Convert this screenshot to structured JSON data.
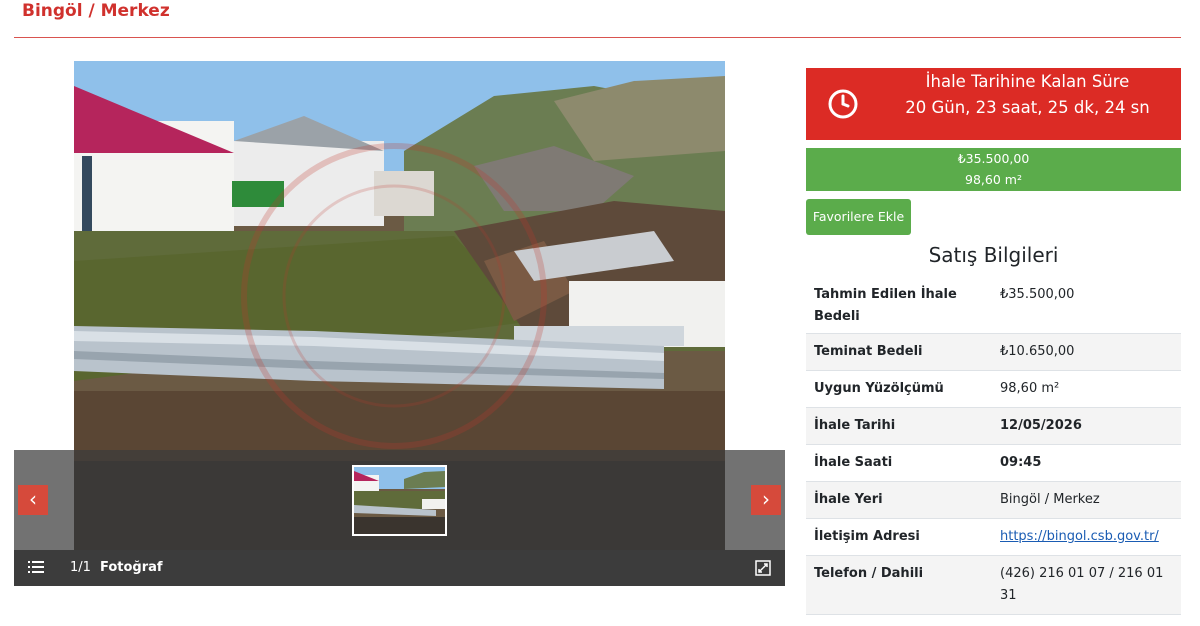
{
  "header": {
    "title": "Bingöl / Merkez"
  },
  "gallery": {
    "counter": "1/1",
    "photo_label": "Fotoğraf",
    "prev_label": "‹",
    "next_label": "›",
    "icons": {
      "list": "list-icon",
      "expand": "expand-icon",
      "prev": "chevron-left-icon",
      "next": "chevron-right-icon"
    }
  },
  "countdown": {
    "title": "İhale Tarihine Kalan Süre",
    "time": "20 Gün, 23 saat, 25 dk, 24 sn",
    "icon": "clock-icon",
    "color": "#dc2b25"
  },
  "price_box": {
    "price": "₺35.500,00",
    "area": "98,60 m²",
    "color": "#5bac4b"
  },
  "favorite_button": {
    "label": "Favorilere Ekle"
  },
  "sale_info": {
    "title": "Satış Bilgileri",
    "rows": [
      {
        "key": "Tahmin Edilen İhale Bedeli",
        "value": "₺35.500,00"
      },
      {
        "key": "Teminat Bedeli",
        "value": "₺10.650,00"
      },
      {
        "key": "Uygun Yüzölçümü",
        "value": "98,60 m²"
      },
      {
        "key": "İhale Tarihi",
        "value": "12/05/2026"
      },
      {
        "key": "İhale Saati",
        "value": "09:45"
      },
      {
        "key": "İhale Yeri",
        "value": "Bingöl / Merkez"
      },
      {
        "key": "İletişim Adresi",
        "value": "https://bingol.csb.gov.tr/"
      },
      {
        "key": "Telefon / Dahili",
        "value": "(426) 216 01 07 / 216 01 31"
      }
    ]
  }
}
